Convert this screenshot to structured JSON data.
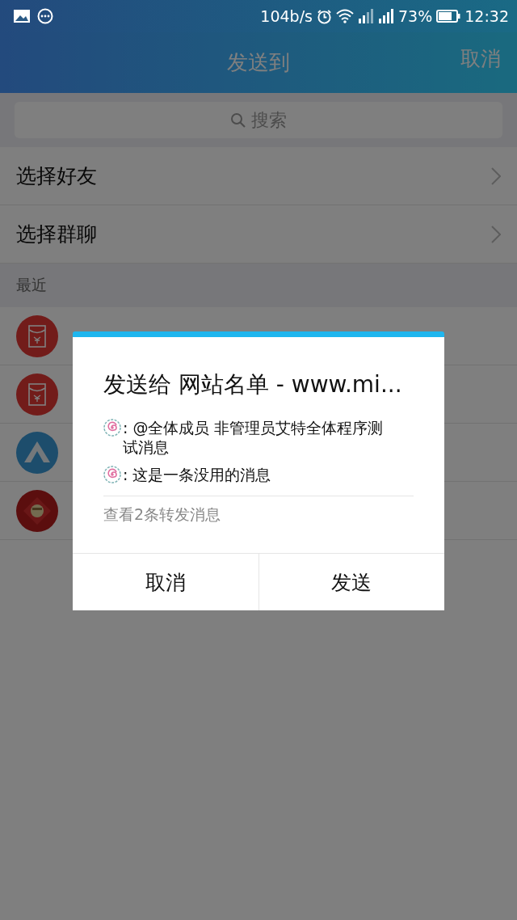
{
  "status_bar": {
    "speed": "104b/s",
    "battery": "73%",
    "time": "12:32"
  },
  "header": {
    "title": "发送到",
    "cancel": "取消"
  },
  "search": {
    "placeholder": "搜索"
  },
  "menu": [
    {
      "label": "选择好友"
    },
    {
      "label": "选择群聊"
    }
  ],
  "recent": {
    "label": "最近",
    "items": [
      {
        "kind": "red-envelope"
      },
      {
        "kind": "red-envelope"
      },
      {
        "kind": "tent"
      },
      {
        "kind": "fu"
      }
    ]
  },
  "dialog": {
    "title": "发送给 网站名单 - www.mi...",
    "messages": [
      {
        "text": ":  @全体成员 非管理员艾特全体程序测试消息"
      },
      {
        "text": ":  这是一条没用的消息"
      }
    ],
    "link": "查看2条转发消息",
    "buttons": [
      {
        "label": "取消"
      },
      {
        "label": "发送"
      }
    ]
  }
}
